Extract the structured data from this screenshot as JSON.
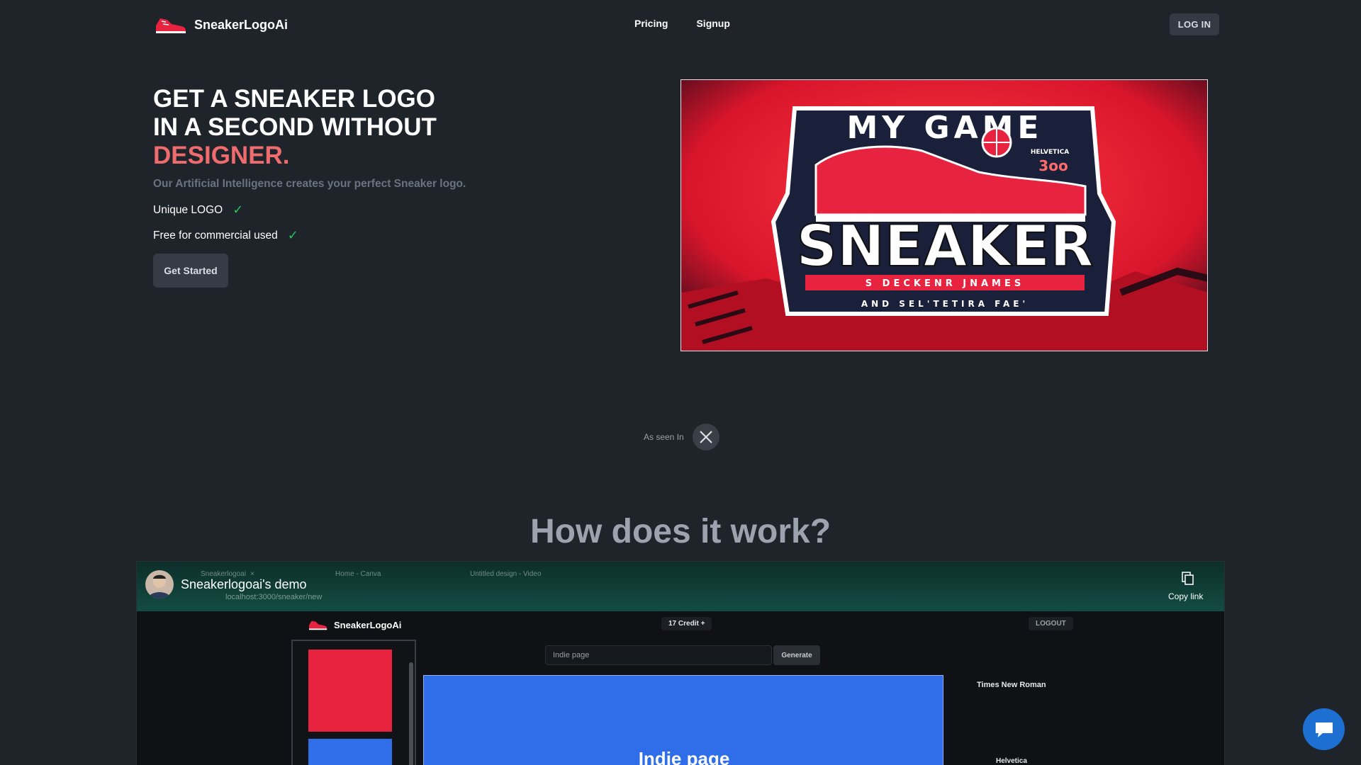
{
  "nav": {
    "brand": "SneakerLogoAi",
    "links": [
      "Pricing",
      "Signup"
    ],
    "login": "LOG IN"
  },
  "hero": {
    "title_line1": "GET A SNEAKER LOGO",
    "title_line2": "IN A SECOND WITHOUT",
    "title_accent": "DESIGNER.",
    "subtitle": "Our Artificial Intelligence creates your perfect Sneaker logo.",
    "features": [
      "Unique LOGO",
      "Free for commercial used"
    ],
    "cta": "Get Started",
    "image_text": {
      "top": "MY GAME",
      "main": "SNEAKER",
      "band": "S DECKENR JNAMES",
      "bottom": "AND SEL'TETIRA FAE'",
      "corner1": "HELVETICA",
      "corner2": "3oo"
    }
  },
  "seen": {
    "label": "As seen In",
    "icon": "x-logo-icon"
  },
  "how": {
    "title": "How does it work?"
  },
  "video": {
    "title": "Sneakerlogoai's demo",
    "copy_link": "Copy link",
    "tabs": [
      "Sneakerlogoai",
      "Home - Canva",
      "Untitled design - Video"
    ],
    "address": "localhost:3000/sneaker/new",
    "app_brand": "SneakerLogoAi",
    "credit": "17 Credit +",
    "logout": "LOGOUT",
    "input_value": "Indie page",
    "generate": "Generate",
    "canvas_text": "Indie page",
    "fonts": [
      "Times New Roman",
      "Helvetica"
    ]
  },
  "colors": {
    "accent": "#ee6b6e",
    "check": "#22c55e",
    "chat": "#1d6fd1"
  }
}
